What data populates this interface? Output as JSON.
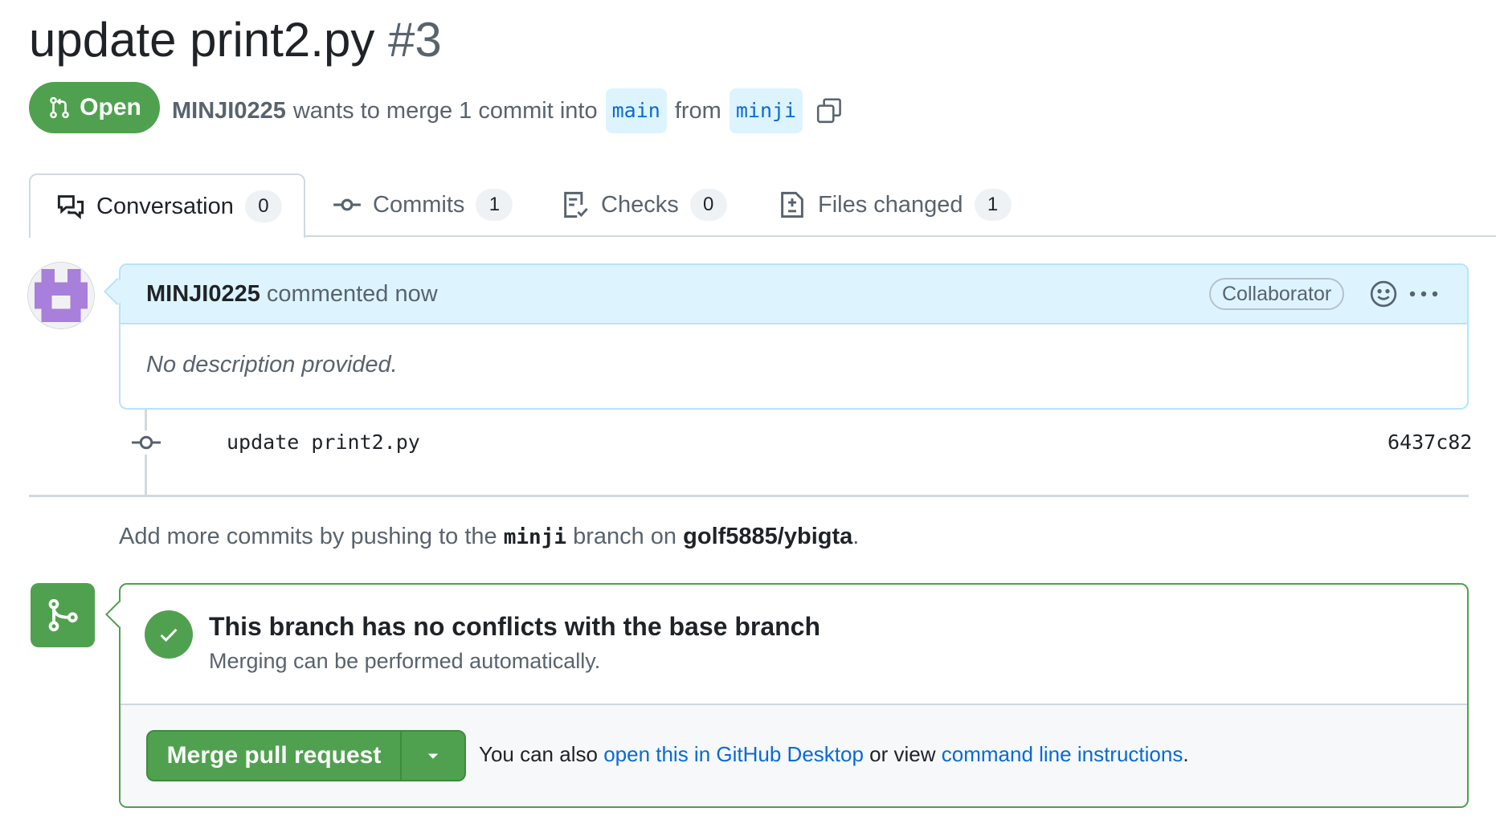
{
  "pr": {
    "title": "update print2.py",
    "number": "#3",
    "state": "Open",
    "author": "MINJI0225",
    "merge_text": "wants to merge 1 commit into",
    "base_branch": "main",
    "from_word": "from",
    "head_branch": "minji"
  },
  "tabs": [
    {
      "label": "Conversation",
      "count": "0",
      "icon": "comment-discussion-icon"
    },
    {
      "label": "Commits",
      "count": "1",
      "icon": "git-commit-icon"
    },
    {
      "label": "Checks",
      "count": "0",
      "icon": "checklist-icon"
    },
    {
      "label": "Files changed",
      "count": "1",
      "icon": "file-diff-icon"
    }
  ],
  "comment": {
    "author": "MINJI0225",
    "action": "commented now",
    "role": "Collaborator",
    "body": "No description provided."
  },
  "commit": {
    "message": "update print2.py",
    "sha": "6437c82"
  },
  "push_hint": {
    "prefix": "Add more commits by pushing to the",
    "branch": "minji",
    "middle": "branch on",
    "repo": "golf5885/ybigta",
    "suffix": "."
  },
  "merge": {
    "status_title": "This branch has no conflicts with the base branch",
    "status_sub": "Merging can be performed automatically.",
    "button_label": "Merge pull request",
    "alt_prefix": "You can also",
    "desktop_link": "open this in GitHub Desktop",
    "alt_middle": "or view",
    "cli_link": "command line instructions",
    "alt_suffix": "."
  },
  "colors": {
    "open_green": "#50a14f",
    "link_blue": "#0969da",
    "branch_bg": "#ddf4ff",
    "avatar_purple": "#a87fdb"
  }
}
